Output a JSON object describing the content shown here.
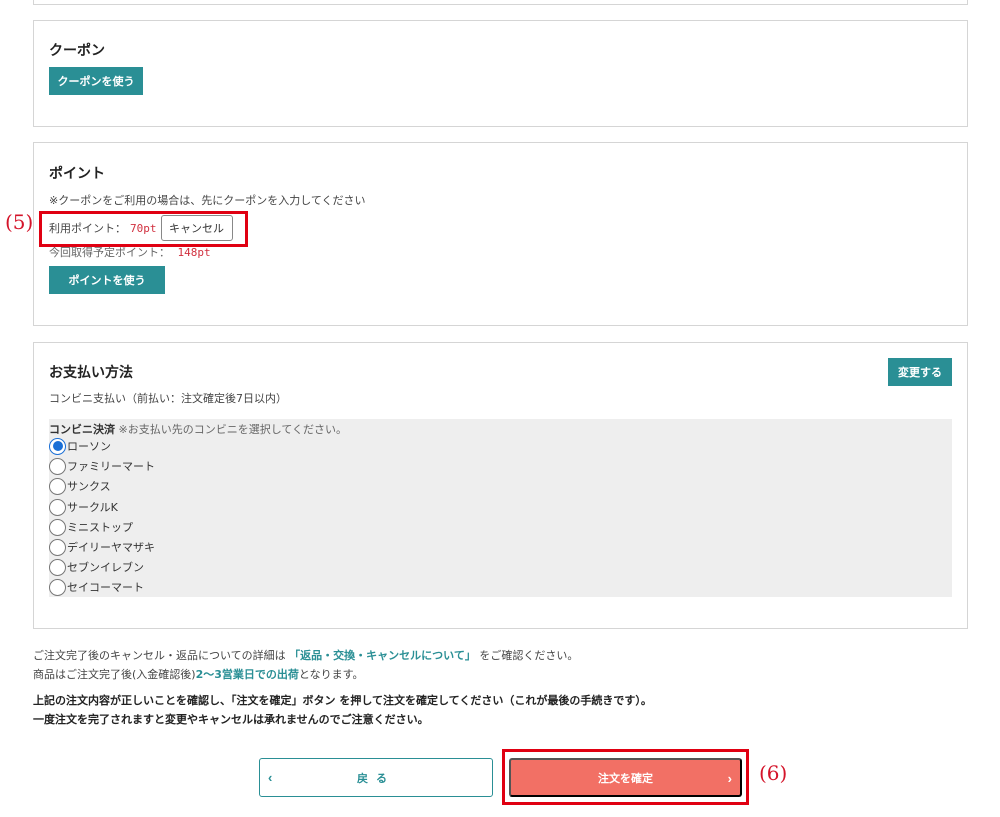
{
  "coupon": {
    "title": "クーポン",
    "button_label": "クーポンを使う"
  },
  "point": {
    "title": "ポイント",
    "note": "※クーポンをご利用の場合は、先にクーポンを入力してください",
    "used_label": "利用ポイント：",
    "used_value": "70pt",
    "cancel_label": "キャンセル",
    "earn_label": "今回取得予定ポイント：",
    "earn_value": "148pt",
    "button_label": "ポイントを使う"
  },
  "payment": {
    "title": "お支払い方法",
    "change_label": "変更する",
    "method_desc": "コンビニ支払い（前払い：注文確定後7日以内）",
    "store_heading": "コンビニ決済",
    "store_hint": "※お支払い先のコンビニを選択してください。",
    "stores": [
      {
        "label": "ローソン",
        "selected": true
      },
      {
        "label": "ファミリーマート",
        "selected": false
      },
      {
        "label": "サンクス",
        "selected": false
      },
      {
        "label": "サークルK",
        "selected": false
      },
      {
        "label": "ミニストップ",
        "selected": false
      },
      {
        "label": "デイリーヤマザキ",
        "selected": false
      },
      {
        "label": "セブンイレブン",
        "selected": false
      },
      {
        "label": "セイコーマート",
        "selected": false
      }
    ]
  },
  "info": {
    "line1_pre": "ご注文完了後のキャンセル・返品についての詳細は",
    "line1_link": "「返品・交換・キャンセルについて」",
    "line1_post": "をご確認ください。",
    "line2_pre": "商品はご注文完了後(入金確認後)",
    "line2_bold": "2〜3営業日での出荷",
    "line2_post": "となります。",
    "warn1": "上記の注文内容が正しいことを確認し、「注文を確定」ボタン を押して注文を確定してください（これが最後の手続きです）。",
    "warn2": "一度注文を完了されますと変更やキャンセルは承れませんのでご注意ください。"
  },
  "actions": {
    "back_label": "戻る",
    "confirm_label": "注文を確定"
  },
  "annotations": {
    "label5": "(5)",
    "label6": "(6)"
  },
  "colors": {
    "accent": "#2a8f95",
    "confirm": "#f27065",
    "highlight": "#e00012",
    "points": "#d1303f"
  }
}
